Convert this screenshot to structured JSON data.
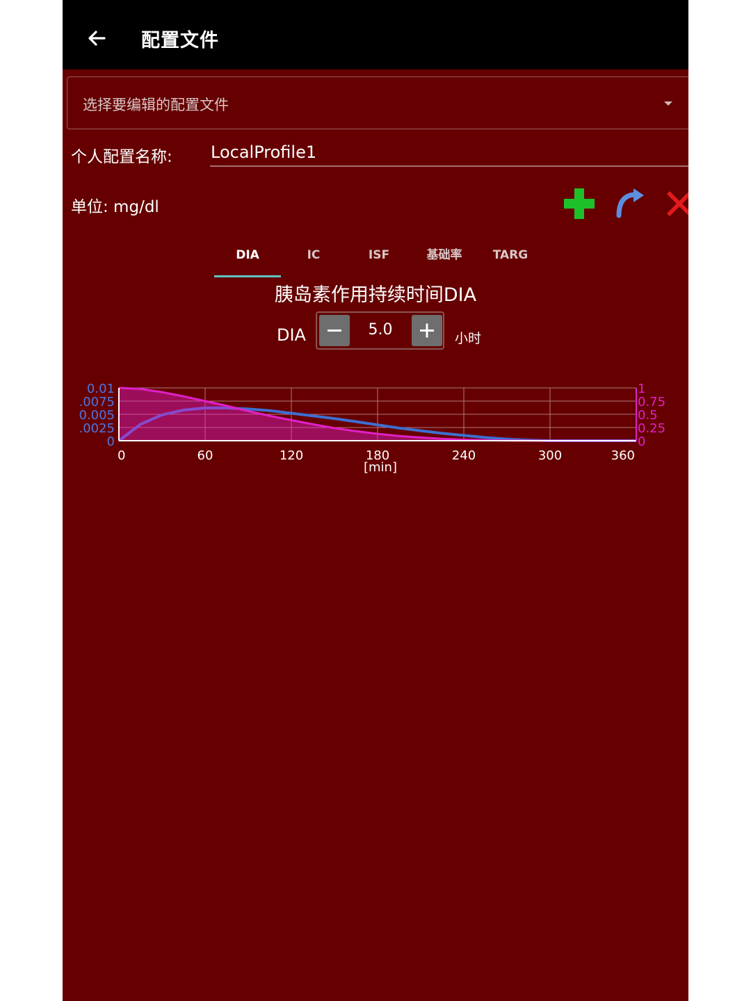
{
  "toolbar": {
    "title": "配置文件",
    "back_icon": "arrow-left-icon"
  },
  "profile_selector": {
    "placeholder": "选择要编辑的配置文件",
    "icon": "chevron-down-icon"
  },
  "profile_name": {
    "label": "个人配置名称:",
    "value": "LocalProfile1"
  },
  "units": {
    "label": "单位: mg/dl"
  },
  "actions": [
    {
      "name": "add",
      "icon": "plus-icon",
      "color": "#1ec02a"
    },
    {
      "name": "undo",
      "icon": "redo-arrow-icon",
      "color": "#5d8ee0"
    },
    {
      "name": "delete",
      "icon": "close-icon",
      "color": "#e31b1b"
    }
  ],
  "tabs": [
    {
      "label": "DIA",
      "active": true
    },
    {
      "label": "IC",
      "active": false
    },
    {
      "label": "ISF",
      "active": false
    },
    {
      "label": "基础率",
      "active": false
    },
    {
      "label": "TARG",
      "active": false
    }
  ],
  "dia_section": {
    "title": "胰岛素作用持续时间DIA",
    "field_label": "DIA",
    "value": "5.0",
    "unit": "小时"
  },
  "colors": {
    "background": "#660000",
    "toolbar": "#000000",
    "tab_indicator": "#5fc5c3",
    "activity_series": "#3d6fd1",
    "iob_series": "#e020c8"
  },
  "chart_data": {
    "type": "line",
    "xlabel": "[min]",
    "x_ticks": [
      0,
      60,
      120,
      180,
      240,
      300,
      360
    ],
    "xlim": [
      0,
      360
    ],
    "y_left": {
      "ticks": [
        "0",
        ".0025",
        "0.005",
        ".0075",
        "0.01"
      ],
      "lim": [
        0,
        0.01
      ]
    },
    "y_right": {
      "ticks": [
        "0",
        "0.25",
        "0.5",
        "0.75",
        "1"
      ],
      "lim": [
        0,
        1
      ]
    },
    "grid": true,
    "series": [
      {
        "axis": "left",
        "fill": false,
        "x": [
          0,
          15,
          30,
          45,
          60,
          75,
          90,
          105,
          120,
          135,
          150,
          165,
          180,
          195,
          210,
          225,
          240,
          255,
          270,
          285,
          300,
          330,
          360
        ],
        "y": [
          0,
          0.0031,
          0.0049,
          0.0058,
          0.0062,
          0.0062,
          0.006,
          0.0057,
          0.0052,
          0.0047,
          0.0042,
          0.0036,
          0.003,
          0.0024,
          0.0019,
          0.0014,
          0.001,
          0.0006,
          0.0003,
          0.0001,
          0,
          0,
          0
        ]
      },
      {
        "axis": "right",
        "fill": true,
        "x": [
          0,
          15,
          30,
          45,
          60,
          75,
          90,
          105,
          120,
          135,
          150,
          165,
          180,
          195,
          210,
          225,
          240,
          255,
          270,
          285,
          300,
          330,
          360
        ],
        "y": [
          1.0,
          0.98,
          0.92,
          0.84,
          0.75,
          0.66,
          0.56,
          0.47,
          0.39,
          0.31,
          0.24,
          0.18,
          0.13,
          0.09,
          0.06,
          0.035,
          0.02,
          0.01,
          0.004,
          0.001,
          0,
          0,
          0
        ]
      }
    ]
  }
}
